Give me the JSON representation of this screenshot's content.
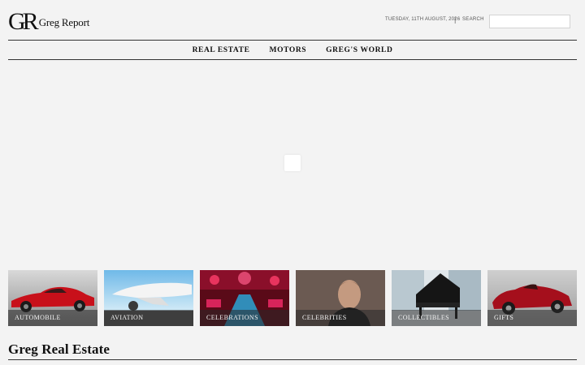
{
  "header": {
    "logo_mark": "GR",
    "logo_text": "Greg Report",
    "date": "TUESDAY, 11TH AUGUST, 2026",
    "separator": "|",
    "search_label": "SEARCH",
    "search_value": "",
    "search_placeholder": ""
  },
  "nav": {
    "items": [
      {
        "label": "REAL ESTATE"
      },
      {
        "label": "MOTORS"
      },
      {
        "label": "GREG'S WORLD"
      }
    ]
  },
  "categories": [
    {
      "label": "AUTOMOBILE",
      "icon": "red-sports-car"
    },
    {
      "label": "AVIATION",
      "icon": "private-jet"
    },
    {
      "label": "CELEBRATIONS",
      "icon": "party-venue"
    },
    {
      "label": "CELEBRITIES",
      "icon": "celebrity-portrait"
    },
    {
      "label": "COLLECTIBLES",
      "icon": "grand-piano"
    },
    {
      "label": "GIFTS",
      "icon": "vintage-race-car"
    }
  ],
  "section": {
    "title": "Greg Real Estate"
  },
  "colors": {
    "background": "#f3f3f3",
    "text": "#111111",
    "rule": "#333333",
    "accent_red": "#c8101a"
  }
}
